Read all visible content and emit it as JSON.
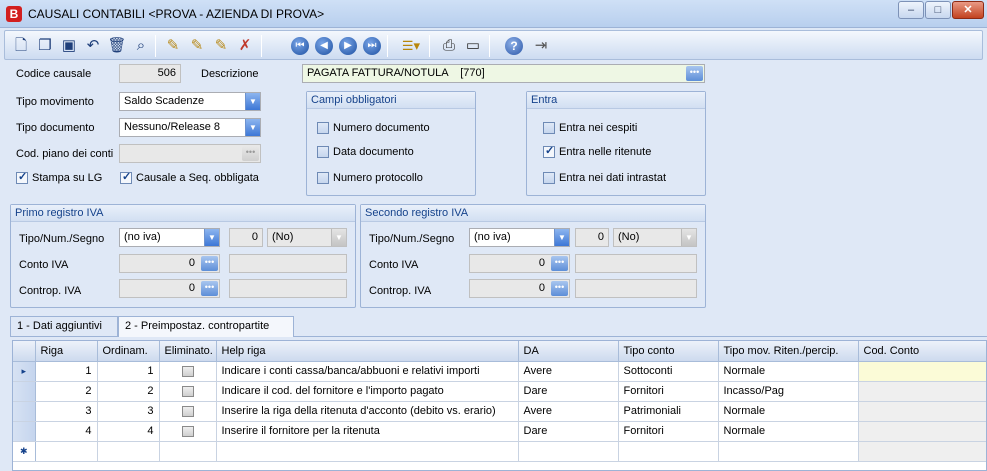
{
  "window": {
    "title": "CAUSALI CONTABILI <PROVA - AZIENDA DI PROVA>",
    "app_icon_letter": "B",
    "controls": {
      "minimize": "–",
      "maximize": "□",
      "close": "✕"
    }
  },
  "toolbar": {
    "icons": [
      "new-doc",
      "copy-doc",
      "save",
      "undo",
      "delete",
      "find",
      "edit-pencil-1",
      "edit-pencil-2",
      "edit-pencil-3",
      "cancel-edit",
      "first",
      "prev",
      "next",
      "last",
      "list-view",
      "print",
      "preview",
      "help",
      "exit"
    ]
  },
  "form": {
    "codice_causale_label": "Codice causale",
    "codice_causale_value": "506",
    "descrizione_label": "Descrizione",
    "descrizione_value": "PAGATA FATTURA/NOTULA    [770]",
    "tipo_movimento_label": "Tipo movimento",
    "tipo_movimento_value": "Saldo Scadenze",
    "tipo_documento_label": "Tipo documento",
    "tipo_documento_value": "Nessuno/Release 8",
    "cod_piano_label": "Cod. piano dei conti",
    "cod_piano_value": "",
    "stampa_lg_label": "Stampa  su LG",
    "stampa_lg_checked": true,
    "causale_seq_label": "Causale a Seq. obbligata",
    "causale_seq_checked": true
  },
  "campi_obbligatori": {
    "title": "Campi obbligatori",
    "items": [
      {
        "label": "Numero documento",
        "checked": false
      },
      {
        "label": "Data documento",
        "checked": false
      },
      {
        "label": "Numero protocollo",
        "checked": false
      }
    ]
  },
  "entra": {
    "title": "Entra",
    "items": [
      {
        "label": "Entra nei cespiti",
        "checked": false
      },
      {
        "label": "Entra nelle ritenute",
        "checked": true
      },
      {
        "label": "Entra nei dati intrastat",
        "checked": false
      }
    ]
  },
  "primo_registro": {
    "title": "Primo registro IVA",
    "tipo_label": "Tipo/Num./Segno",
    "tipo_value": "(no iva)",
    "num_value": "0",
    "segno_value": "(No)",
    "conto_label": "Conto IVA",
    "conto_value": "0",
    "controp_label": "Controp. IVA",
    "controp_value": "0"
  },
  "secondo_registro": {
    "title": "Secondo registro IVA",
    "tipo_label": "Tipo/Num./Segno",
    "tipo_value": "(no iva)",
    "num_value": "0",
    "segno_value": "(No)",
    "conto_label": "Conto IVA",
    "conto_value": "0",
    "controp_label": "Controp. IVA",
    "controp_value": "0"
  },
  "tabs": [
    {
      "label": "1 - Dati aggiuntivi",
      "active": false
    },
    {
      "label": "2 - Preimpostaz. contropartite",
      "active": true
    }
  ],
  "grid": {
    "columns": [
      "Riga",
      "Ordinam.",
      "Eliminato.",
      "Help riga",
      "DA",
      "Tipo conto",
      "Tipo mov. Riten./percip.",
      "Cod. Conto"
    ],
    "rows": [
      {
        "riga": "1",
        "ordinam": "1",
        "help": "Indicare i conti cassa/banca/abbuoni e relativi importi",
        "da": "Avere",
        "tipo_conto": "Sottoconti",
        "tipo_mov": "Normale",
        "cod_conto": ""
      },
      {
        "riga": "2",
        "ordinam": "2",
        "help": "Indicare il cod. del fornitore e l'importo pagato",
        "da": "Dare",
        "tipo_conto": "Fornitori",
        "tipo_mov": "Incasso/Pag",
        "cod_conto": ""
      },
      {
        "riga": "3",
        "ordinam": "3",
        "help": "Inserire la riga della ritenuta d'acconto (debito vs. erario)",
        "da": "Avere",
        "tipo_conto": "Patrimoniali",
        "tipo_mov": "Normale",
        "cod_conto": ""
      },
      {
        "riga": "4",
        "ordinam": "4",
        "help": "Inserire il fornitore per la ritenuta",
        "da": "Dare",
        "tipo_conto": "Fornitori",
        "tipo_mov": "Normale",
        "cod_conto": ""
      }
    ],
    "current_row_marker": "▸",
    "new_row_marker": "✱"
  },
  "colors": {
    "accent": "#15428b",
    "bg": "#dfe8f6",
    "highlight_cell": "#fbfbd7",
    "desc_field": "#eef7e4"
  }
}
